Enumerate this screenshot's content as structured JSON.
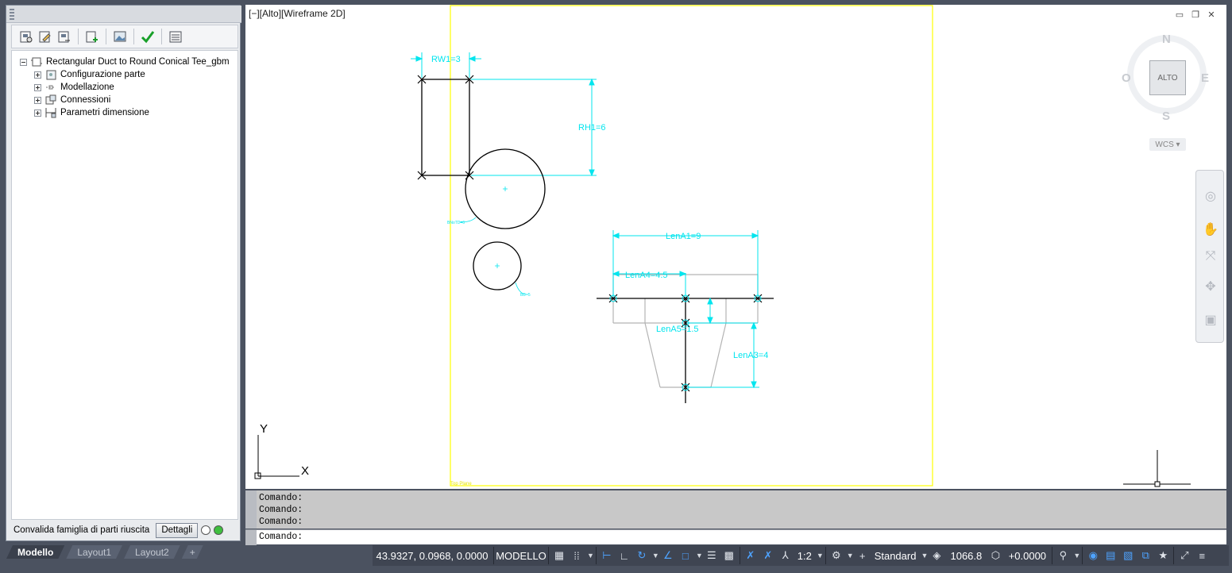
{
  "viewport": {
    "label": "[−][Alto][Wireframe 2D]",
    "viewcube_face": "ALTO",
    "compass": {
      "n": "N",
      "s": "S",
      "e": "E",
      "w": "O"
    },
    "wcs": "WCS ▾",
    "ucs_y": "Y",
    "ucs_x": "X",
    "plane_label": "Top Plane"
  },
  "drawing": {
    "dims": {
      "rw1": "RW1=3",
      "rh1": "RH1=6",
      "lena1": "LenA1=9",
      "lena4": "LenA4=4.5",
      "lena5": "LenA5=1.5",
      "lena3": "LenA3=4",
      "small_circle_label": "BD=5",
      "large_circle_label": "BNoTD=6"
    }
  },
  "panel": {
    "tree": [
      {
        "label": "Rectangular Duct to Round Conical Tee_gbm",
        "icon": "part-family-icon",
        "expander": "minus"
      },
      {
        "label": "Configurazione parte",
        "icon": "configuration-icon",
        "expander": "plus"
      },
      {
        "label": "Modellazione",
        "icon": "modeling-icon",
        "expander": "plus"
      },
      {
        "label": "Connessioni",
        "icon": "connections-icon",
        "expander": "plus"
      },
      {
        "label": "Parametri dimensione",
        "icon": "dimension-params-icon",
        "expander": "plus"
      }
    ],
    "validation_text": "Convalida famiglia di parti riuscita",
    "details_label": "Dettagli"
  },
  "command_line": {
    "history": [
      "Comando:",
      "Comando:",
      "Comando:"
    ],
    "prompt": "Comando:"
  },
  "layout_tabs": [
    "Modello",
    "Layout1",
    "Layout2",
    "+"
  ],
  "status_bar": {
    "coordinates": "43.9327, 0.0968, 0.0000",
    "space": "MODELLO",
    "scale": "1:2",
    "style": "Standard",
    "elevation": "1066.8",
    "offset": "+0.0000"
  },
  "colors": {
    "dimension": "#00e5ee",
    "frame": "#ffff00",
    "geometry": "#000000",
    "ghost": "#b3b3b3",
    "status_bar": "#3f4552"
  }
}
